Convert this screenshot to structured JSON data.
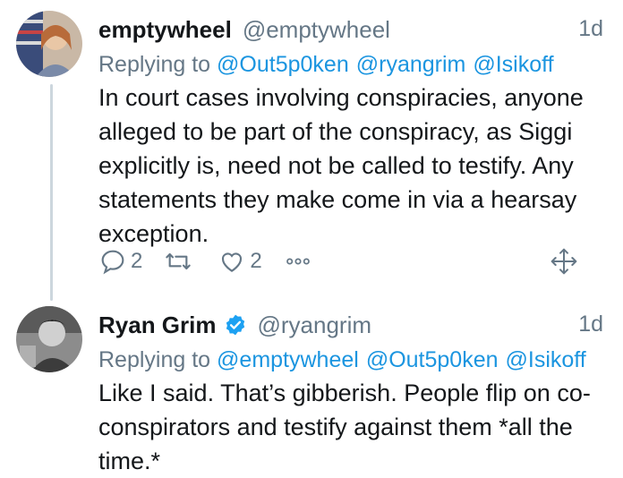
{
  "tweets": [
    {
      "name": "emptywheel",
      "handle": "@emptywheel",
      "time": "1d",
      "replying_label": "Replying to",
      "mentions": [
        "@Out5p0ken",
        "@ryangrim",
        "@Isikoff"
      ],
      "text": "In court cases involving conspiracies, anyone alleged to be part of the conspiracy, as Siggi explicitly is, need not be called to testify. Any statements they make come in via a hearsay exception.",
      "reply_count": "2",
      "retweet_count": "",
      "like_count": "2"
    },
    {
      "name": "Ryan Grim",
      "handle": "@ryangrim",
      "time": "1d",
      "verified": true,
      "replying_label": "Replying to",
      "mentions": [
        "@emptywheel",
        "@Out5p0ken",
        "@Isikoff"
      ],
      "text": "Like I said. That’s gibberish. People flip on co-conspirators and testify against them *all the time.*"
    }
  ],
  "icons": [
    "reply-icon",
    "retweet-icon",
    "like-icon",
    "more-icon",
    "move-icon",
    "verified-icon"
  ],
  "colors": {
    "link": "#1b95e0",
    "secondary": "#657786",
    "verified": "#1da1f2"
  }
}
